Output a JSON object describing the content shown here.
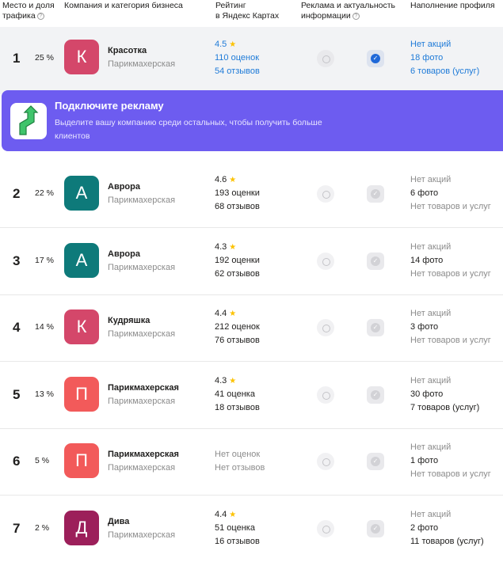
{
  "header": {
    "place_line1": "Место и доля",
    "place_line2": "трафика",
    "company": "Компания и категория бизнеса",
    "rating_line1": "Рейтинг",
    "rating_line2": "в Яндекс Картах",
    "ads_line1": "Реклама и актуальность",
    "ads_line2": "информации",
    "profile": "Наполнение профиля",
    "help_glyph": "?"
  },
  "promo": {
    "title": "Подключите рекламу",
    "text": "Выделите вашу компанию среди остальных, чтобы получить больше клиентов"
  },
  "rows": [
    {
      "place": "1",
      "share": "25 %",
      "letter": "К",
      "avatar_color": "#d4476a",
      "name": "Красотка",
      "category": "Парикмахерская",
      "rating": "4.5",
      "star": "★",
      "reviews_count": "110 оценок",
      "reviews": "54 отзывов",
      "promos": "Нет акций",
      "photos": "18 фото",
      "goods": "6 товаров (услуг)"
    },
    {
      "place": "2",
      "share": "22 %",
      "letter": "А",
      "avatar_color": "#0e7a7a",
      "name": "Аврора",
      "category": "Парикмахерская",
      "rating": "4.6",
      "star": "★",
      "reviews_count": "193 оценки",
      "reviews": "68 отзывов",
      "promos": "Нет акций",
      "photos": "6 фото",
      "goods": "Нет товаров и услуг"
    },
    {
      "place": "3",
      "share": "17 %",
      "letter": "А",
      "avatar_color": "#0e7a7a",
      "name": "Аврора",
      "category": "Парикмахерская",
      "rating": "4.3",
      "star": "★",
      "reviews_count": "192 оценки",
      "reviews": "62 отзывов",
      "promos": "Нет акций",
      "photos": "14 фото",
      "goods": "Нет товаров и услуг"
    },
    {
      "place": "4",
      "share": "14 %",
      "letter": "К",
      "avatar_color": "#d4476a",
      "name": "Кудряшка",
      "category": "Парикмахерская",
      "rating": "4.4",
      "star": "★",
      "reviews_count": "212 оценок",
      "reviews": "76 отзывов",
      "promos": "Нет акций",
      "photos": "3 фото",
      "goods": "Нет товаров и услуг"
    },
    {
      "place": "5",
      "share": "13 %",
      "letter": "П",
      "avatar_color": "#f25a5a",
      "name": "Парикмахерская",
      "category": "Парикмахерская",
      "rating": "4.3",
      "star": "★",
      "reviews_count": "41 оценка",
      "reviews": "18 отзывов",
      "promos": "Нет акций",
      "photos": "30 фото",
      "goods": "7 товаров (услуг)"
    },
    {
      "place": "6",
      "share": "5 %",
      "letter": "П",
      "avatar_color": "#f25a5a",
      "name": "Парикмахерская",
      "category": "Парикмахерская",
      "rating": "",
      "star": "",
      "reviews_count": "Нет оценок",
      "reviews": "Нет отзывов",
      "promos": "Нет акций",
      "photos": "1 фото",
      "goods": "Нет товаров и услуг"
    },
    {
      "place": "7",
      "share": "2 %",
      "letter": "Д",
      "avatar_color": "#9c1f5a",
      "name": "Дива",
      "category": "Парикмахерская",
      "rating": "4.4",
      "star": "★",
      "reviews_count": "51 оценка",
      "reviews": "16 отзывов",
      "promos": "Нет акций",
      "photos": "2 фото",
      "goods": "11 товаров (услуг)"
    }
  ],
  "icons": {
    "ad": "megaphone-icon",
    "actual": "checkmark-icon",
    "check_glyph": "✓"
  }
}
